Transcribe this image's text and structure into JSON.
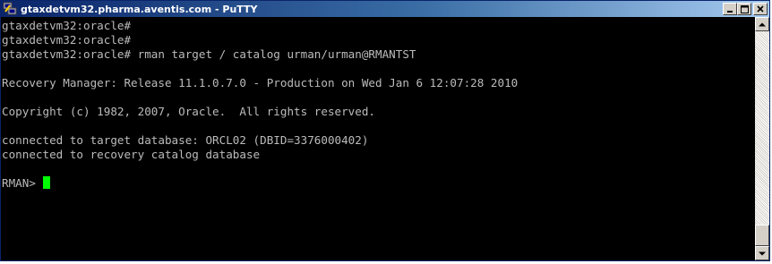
{
  "window": {
    "title": "gtaxdetvm32.pharma.aventis.com - PuTTY",
    "icon": "putty-icon",
    "buttons": {
      "minimize": "_",
      "maximize": "□",
      "close": "×"
    }
  },
  "terminal": {
    "lines": [
      "gtaxdetvm32:oracle#",
      "gtaxdetvm32:oracle#",
      "gtaxdetvm32:oracle# rman target / catalog urman/urman@RMANTST",
      "",
      "Recovery Manager: Release 11.1.0.7.0 - Production on Wed Jan 6 12:07:28 2010",
      "",
      "Copyright (c) 1982, 2007, Oracle.  All rights reserved.",
      "",
      "connected to target database: ORCL02 (DBID=3376000402)",
      "connected to recovery catalog database",
      "",
      "RMAN> "
    ],
    "colors": {
      "background": "#000000",
      "foreground": "#bbbbbb",
      "cursor": "#00ff00"
    }
  },
  "scrollbar": {
    "up_icon": "arrow-up-icon",
    "down_icon": "arrow-down-icon"
  }
}
